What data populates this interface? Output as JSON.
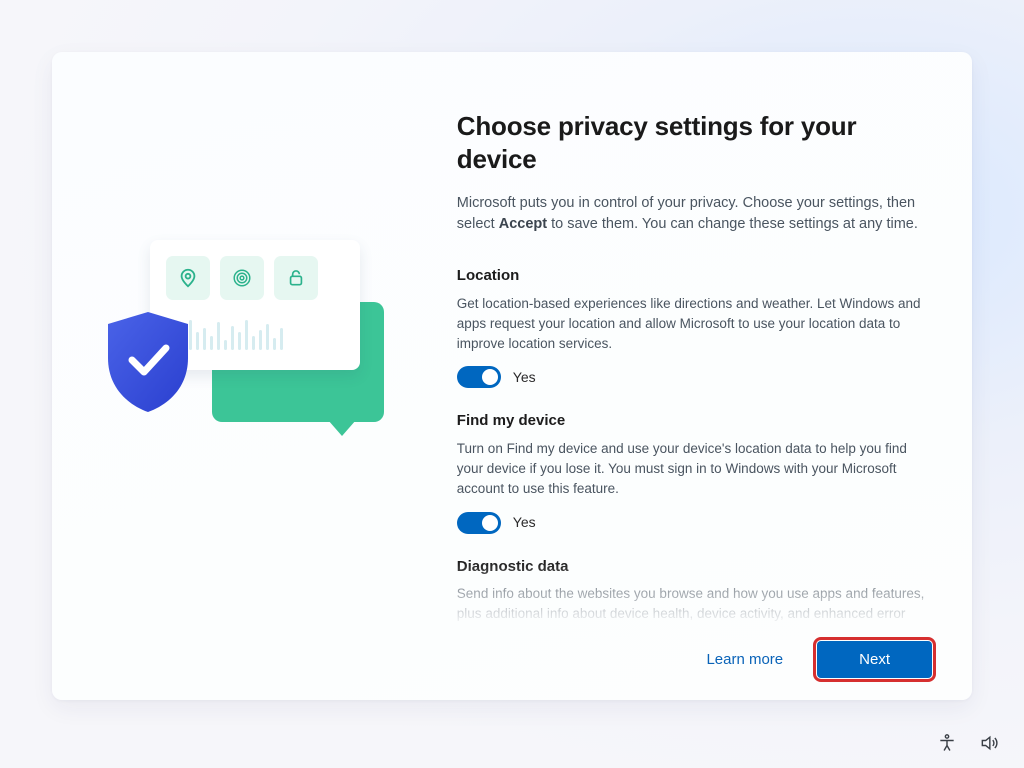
{
  "header": {
    "title": "Choose privacy settings for your device",
    "intro_pre": "Microsoft puts you in control of your privacy. Choose your settings, then select ",
    "intro_bold": "Accept",
    "intro_post": " to save them. You can change these settings at any time."
  },
  "settings": {
    "location": {
      "title": "Location",
      "desc": "Get location-based experiences like directions and weather. Let Windows and apps request your location and allow Microsoft to use your location data to improve location services.",
      "value": "Yes"
    },
    "find_my_device": {
      "title": "Find my device",
      "desc": "Turn on Find my device and use your device's location data to help you find your device if you lose it. You must sign in to Windows with your Microsoft account to use this feature.",
      "value": "Yes"
    },
    "diagnostic": {
      "title": "Diagnostic data",
      "desc": "Send info about the websites you browse and how you use apps and features, plus additional info about device health, device activity, and enhanced error reporting."
    }
  },
  "footer": {
    "learn_more": "Learn more",
    "next": "Next"
  },
  "colors": {
    "accent": "#0067c0",
    "link": "#0a63b8",
    "highlight_outline": "#d62f2f",
    "illustration_green": "#3cc597",
    "illustration_shield1": "#3858d6",
    "illustration_shield2": "#2a3fcf"
  }
}
